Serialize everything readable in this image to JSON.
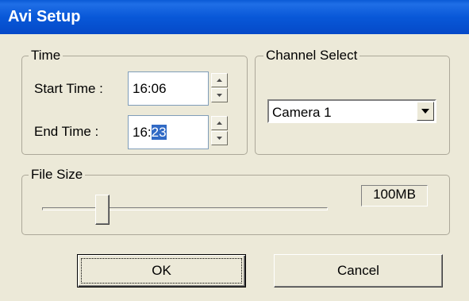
{
  "window": {
    "title": "Avi Setup"
  },
  "time_group": {
    "legend": "Time",
    "start_label": "Start Time :",
    "start_hour": "16",
    "start_colon": ":",
    "start_minute": "06",
    "end_label": "End Time :",
    "end_hour": "16",
    "end_colon": ":",
    "end_minute_selected": "23"
  },
  "channel_group": {
    "legend": "Channel Select",
    "selected": "Camera 1"
  },
  "file_size_group": {
    "legend": "File Size",
    "value": "100MB",
    "slider_fraction": 0.21
  },
  "buttons": {
    "ok": "OK",
    "cancel": "Cancel"
  },
  "icons": [
    "spin-up-icon",
    "spin-down-icon",
    "dropdown-arrow-icon"
  ]
}
